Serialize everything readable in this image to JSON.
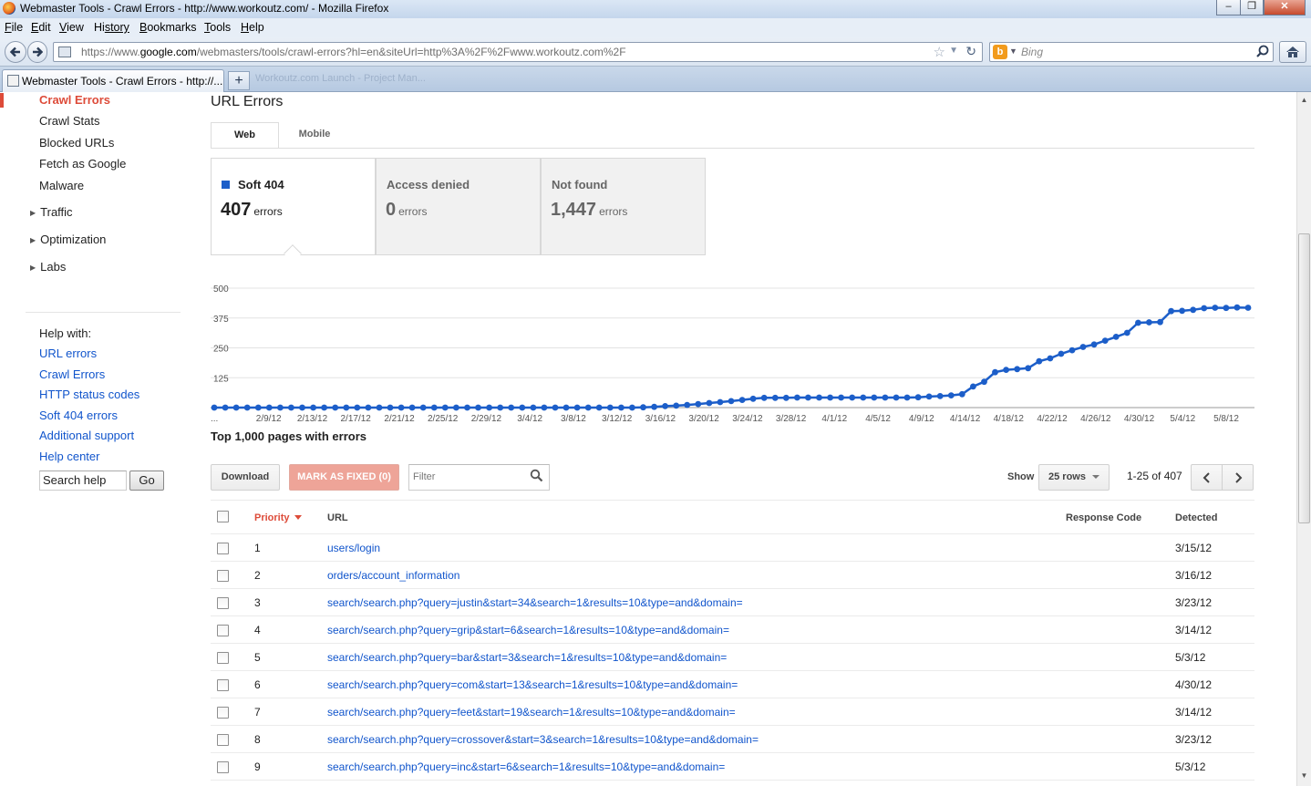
{
  "window": {
    "title": "Webmaster Tools - Crawl Errors - http://www.workoutz.com/ - Mozilla Firefox",
    "minimize": "–",
    "restore": "❐",
    "close": "✕"
  },
  "menubar": {
    "items": [
      {
        "first": "F",
        "rest": "ile"
      },
      {
        "first": "E",
        "rest": "dit"
      },
      {
        "first": "V",
        "rest": "iew"
      },
      {
        "first": "Hi",
        "rest": "story",
        "u_index": 1
      },
      {
        "first": "B",
        "rest": "ookmarks"
      },
      {
        "first": "T",
        "rest": "ools"
      },
      {
        "first": "H",
        "rest": "elp"
      }
    ]
  },
  "navbar": {
    "url_prefix": "https://www.",
    "url_domain": "google.com",
    "url_rest": "/webmasters/tools/crawl-errors?hl=en&siteUrl=http%3A%2F%2Fwww.workoutz.com%2F",
    "search_placeholder": "Bing",
    "search_engine_letter": "b"
  },
  "tabs": {
    "active_label": "Webmaster Tools - Crawl Errors - http://...",
    "background_label": "Workoutz.com Launch - Project Man..."
  },
  "sidebar": {
    "items": [
      "Crawl Errors",
      "Crawl Stats",
      "Blocked URLs",
      "Fetch as Google",
      "Malware"
    ],
    "groups": [
      "Traffic",
      "Optimization",
      "Labs"
    ],
    "help_heading": "Help with:",
    "help_links": [
      "URL errors",
      "Crawl Errors",
      "HTTP status codes",
      "Soft 404 errors",
      "Additional support",
      "Help center"
    ],
    "search_help_value": "Search help",
    "go_label": "Go"
  },
  "main": {
    "heading": "URL Errors",
    "subtabs": [
      "Web",
      "Mobile"
    ],
    "cards": [
      {
        "title": "Soft 404",
        "count": "407",
        "unit": "errors",
        "swatch_color": "#1c5ec9"
      },
      {
        "title": "Access denied",
        "count": "0",
        "unit": "errors"
      },
      {
        "title": "Not found",
        "count": "1,447",
        "unit": "errors"
      }
    ],
    "table_heading": "Top 1,000 pages with errors",
    "download_label": "Download",
    "mark_fixed_label": "MARK AS FIXED (0)",
    "filter_placeholder": "Filter",
    "show_label": "Show",
    "rows_option": "25 rows",
    "range_text": "1-25 of 407",
    "columns": {
      "priority": "Priority",
      "url": "URL",
      "response_code": "Response Code",
      "detected": "Detected"
    },
    "rows": [
      {
        "priority": "1",
        "url": "users/login",
        "detected": "3/15/12"
      },
      {
        "priority": "2",
        "url": "orders/account_information",
        "detected": "3/16/12"
      },
      {
        "priority": "3",
        "url": "search/search.php?query=justin&start=34&search=1&results=10&type=and&domain=",
        "detected": "3/23/12"
      },
      {
        "priority": "4",
        "url": "search/search.php?query=grip&start=6&search=1&results=10&type=and&domain=",
        "detected": "3/14/12"
      },
      {
        "priority": "5",
        "url": "search/search.php?query=bar&start=3&search=1&results=10&type=and&domain=",
        "detected": "5/3/12"
      },
      {
        "priority": "6",
        "url": "search/search.php?query=com&start=13&search=1&results=10&type=and&domain=",
        "detected": "4/30/12"
      },
      {
        "priority": "7",
        "url": "search/search.php?query=feet&start=19&search=1&results=10&type=and&domain=",
        "detected": "3/14/12"
      },
      {
        "priority": "8",
        "url": "search/search.php?query=crossover&start=3&search=1&results=10&type=and&domain=",
        "detected": "3/23/12"
      },
      {
        "priority": "9",
        "url": "search/search.php?query=inc&start=6&search=1&results=10&type=and&domain=",
        "detected": "5/3/12"
      }
    ]
  },
  "chart_data": {
    "type": "line",
    "series": [
      {
        "name": "Soft 404",
        "color": "#1c5ec9"
      }
    ],
    "y_ticks": [
      "500",
      "375",
      "250",
      "125"
    ],
    "ylim": [
      0,
      500
    ],
    "x_tick_labels": [
      "...",
      "2/9/12",
      "2/13/12",
      "2/17/12",
      "2/21/12",
      "2/25/12",
      "2/29/12",
      "3/4/12",
      "3/8/12",
      "3/12/12",
      "3/16/12",
      "3/20/12",
      "3/24/12",
      "3/28/12",
      "4/1/12",
      "4/5/12",
      "4/9/12",
      "4/14/12",
      "4/18/12",
      "4/22/12",
      "4/26/12",
      "4/30/12",
      "5/4/12",
      "5/8/12"
    ],
    "values": [
      0,
      0,
      0,
      0,
      0,
      0,
      0,
      0,
      0,
      0,
      0,
      0,
      0,
      0,
      0,
      0,
      0,
      0,
      0,
      0,
      0,
      0,
      0,
      0,
      0,
      0,
      0,
      0,
      0,
      0,
      0,
      0,
      0,
      0,
      0,
      0,
      0,
      0,
      0,
      1,
      3,
      6,
      8,
      11,
      15,
      19,
      23,
      27,
      32,
      37,
      41,
      41,
      41,
      42,
      42,
      42,
      42,
      42,
      42,
      42,
      42,
      42,
      42,
      42,
      43,
      46,
      48,
      51,
      56,
      88,
      108,
      148,
      158,
      161,
      165,
      194,
      206,
      225,
      240,
      254,
      264,
      280,
      296,
      313,
      355,
      357,
      358,
      404,
      405,
      409,
      416,
      418,
      417,
      419,
      418
    ]
  }
}
